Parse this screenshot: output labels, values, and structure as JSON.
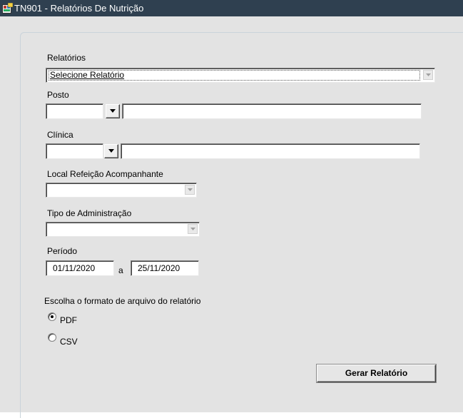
{
  "window": {
    "title": "TN901 - Relatórios De Nutrição",
    "icon": "app-form-icon"
  },
  "form": {
    "relatorios": {
      "label": "Relatórios",
      "value": "Selecione Relatório"
    },
    "posto": {
      "label": "Posto",
      "code": "",
      "description": ""
    },
    "clinica": {
      "label": "Clínica",
      "code": "",
      "description": ""
    },
    "local_refeicao": {
      "label": "Local Refeição Acompanhante",
      "value": ""
    },
    "tipo_administracao": {
      "label": "Tipo de Administração",
      "value": ""
    },
    "periodo": {
      "label": "Período",
      "start": "01/11/2020",
      "separator": "a",
      "end": "25/11/2020"
    },
    "formato": {
      "label": "Escolha o formato de arquivo do relatório",
      "options": [
        {
          "label": "PDF",
          "selected": true
        },
        {
          "label": "CSV",
          "selected": false
        }
      ]
    },
    "submit_label": "Gerar Relatório"
  },
  "colors": {
    "titlebar": "#2f4050",
    "panel": "#e3e3e3"
  }
}
